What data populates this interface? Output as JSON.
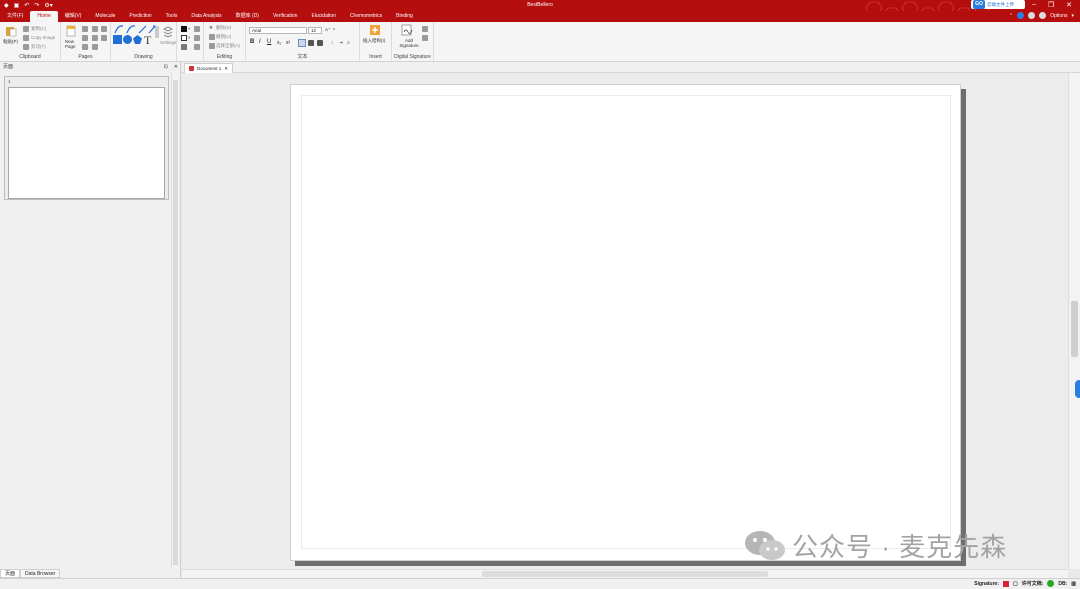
{
  "window": {
    "title": "BestBellero"
  },
  "cloud_button": {
    "icon_text": "GO",
    "label": "云端文件上传"
  },
  "menu": {
    "tabs": [
      "文件(F)",
      "Home",
      "编辑(V)",
      "Molecule",
      "Prediction",
      "Tools",
      "Data Analysis",
      "数据库 (D)",
      "Verification",
      "Elucidation",
      "Chemometrics",
      "Binding"
    ],
    "options_label": "Options"
  },
  "ribbon": {
    "clipboard": {
      "label": "Clipboard",
      "paste": "粘贴(P)",
      "copy": "复制(C)",
      "copy_image": "Copy Image",
      "cut": "剪切(T)"
    },
    "pages": {
      "label": "Pages",
      "new_page": "New Page"
    },
    "drawing": {
      "label": "Drawing",
      "settings": "Settings"
    },
    "editing": {
      "label": "Editing",
      "delete": "删除(D)",
      "undo": "撤销(U)",
      "select_all": "选择全部(A)"
    },
    "text": {
      "label": "文本",
      "font": "Arial",
      "size": "12"
    },
    "insert": {
      "label": "Insert",
      "insert_btn": "插入结构(I)"
    },
    "signature": {
      "label": "Digital Signature",
      "add": "Add Signature"
    }
  },
  "left_pane": {
    "title": "页面",
    "thumb_number": "1"
  },
  "document": {
    "tab_title": "Document 1"
  },
  "bottom_tabs": [
    "页面",
    "Data Browser"
  ],
  "watermark": {
    "text": "公众号 · 麦克先森"
  },
  "status": {
    "signature_label": "Signature:",
    "license_label": "许可文档:",
    "db_label": "DB:"
  },
  "colors": {
    "brand_red": "#b50e0e",
    "shape_blue": "#1f6fd6"
  }
}
